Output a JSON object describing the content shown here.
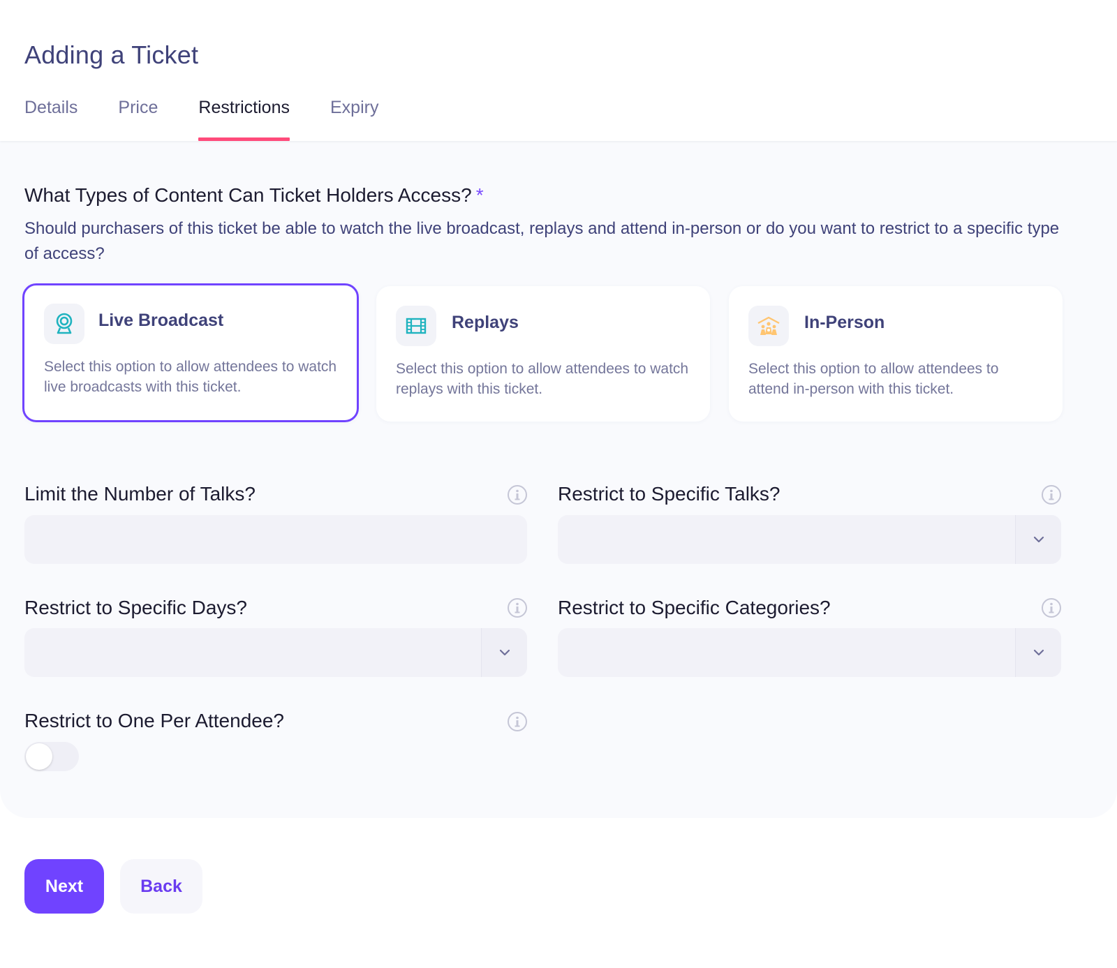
{
  "page": {
    "title": "Adding a Ticket"
  },
  "tabs": [
    {
      "label": "Details",
      "active": false
    },
    {
      "label": "Price",
      "active": false
    },
    {
      "label": "Restrictions",
      "active": true
    },
    {
      "label": "Expiry",
      "active": false
    }
  ],
  "access": {
    "question": "What Types of Content Can Ticket Holders Access?",
    "required_marker": "*",
    "description": "Should purchasers of this ticket be able to watch the live broadcast, replays and attend in-person or do you want to restrict to a specific type of access?",
    "options": [
      {
        "title": "Live Broadcast",
        "description": "Select this option to allow attendees to watch live broadcasts with this ticket.",
        "icon": "webcam-icon",
        "selected": true
      },
      {
        "title": "Replays",
        "description": "Select this option to allow attendees to watch replays with this ticket.",
        "icon": "film-icon",
        "selected": false
      },
      {
        "title": "In-Person",
        "description": "Select this option to allow attendees to attend in-person with this ticket.",
        "icon": "people-house-icon",
        "selected": false
      }
    ]
  },
  "fields": {
    "limit_talks": {
      "label": "Limit the Number of Talks?",
      "value": ""
    },
    "specific_talks": {
      "label": "Restrict to Specific Talks?",
      "value": ""
    },
    "specific_days": {
      "label": "Restrict to Specific Days?",
      "value": ""
    },
    "specific_categories": {
      "label": "Restrict to Specific Categories?",
      "value": ""
    },
    "one_per_attendee": {
      "label": "Restrict to One Per Attendee?",
      "enabled": false
    }
  },
  "buttons": {
    "next": "Next",
    "back": "Back"
  },
  "colors": {
    "accent": "#7043ff",
    "tab_indicator": "#ff4a7a",
    "title": "#3f4279",
    "icon_teal": "#1fb3bf",
    "icon_orange": "#ffc571"
  }
}
